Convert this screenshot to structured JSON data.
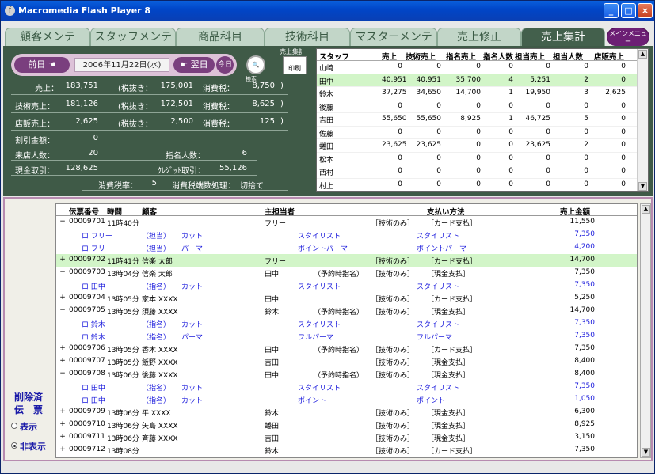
{
  "window": {
    "title": "Macromedia Flash Player 8",
    "min": "_",
    "max": "□",
    "close": "×"
  },
  "tabs": [
    "顧客メンテ",
    "スタッフメンテ",
    "商品科目",
    "技術科目",
    "マスターメンテ",
    "売上修正",
    "売上集計"
  ],
  "menu_btn": "メインメニュー",
  "datebar": {
    "prev": "前日",
    "date": "2006年11月22日(水)",
    "next": "翌日",
    "today": "今日"
  },
  "search_label": "検索",
  "print": {
    "top": "売上集計",
    "label": "印刷"
  },
  "summary": {
    "sales_label": "売上：",
    "sales": "183,751",
    "taxex_label": "(税抜き：",
    "sales_ex": "175,001",
    "tax_label": "消費税：",
    "sales_tax": "8,750",
    "tech_label": "技術売上：",
    "tech": "181,126",
    "tech_ex": "172,501",
    "tech_tax": "8,625",
    "shop_label": "店販売上：",
    "shop": "2,625",
    "shop_ex": "2,500",
    "shop_tax": "125",
    "discount_label": "割引金額：",
    "discount": "0",
    "visitors_label": "来店人数：",
    "visitors": "20",
    "nominated_label": "指名人数：",
    "nominated": "6",
    "cash_label": "現金取引：",
    "cash": "128,625",
    "credit_label": "ｸﾚｼﾞｯﾄ取引：",
    "credit": "55,126",
    "taxrate_label": "消費税率：",
    "taxrate": "5",
    "rounding_label": "消費税端数処理：",
    "rounding": "切捨て",
    "paren": ")"
  },
  "staff_headers": [
    "スタッフ",
    "売上",
    "技術売上",
    "指名売上",
    "指名人数",
    "担当売上",
    "担当人数",
    "店販売上"
  ],
  "staff_rows": [
    [
      "山崎",
      "0",
      "0",
      "0",
      "0",
      "0",
      "0",
      "0"
    ],
    [
      "田中",
      "40,951",
      "40,951",
      "35,700",
      "4",
      "5,251",
      "2",
      "0"
    ],
    [
      "鈴木",
      "37,275",
      "34,650",
      "14,700",
      "1",
      "19,950",
      "3",
      "2,625"
    ],
    [
      "後藤",
      "0",
      "0",
      "0",
      "0",
      "0",
      "0",
      "0"
    ],
    [
      "吉田",
      "55,650",
      "55,650",
      "8,925",
      "1",
      "46,725",
      "5",
      "0"
    ],
    [
      "佐藤",
      "0",
      "0",
      "0",
      "0",
      "0",
      "0",
      "0"
    ],
    [
      "蜷田",
      "23,625",
      "23,625",
      "0",
      "0",
      "23,625",
      "2",
      "0"
    ],
    [
      "松本",
      "0",
      "0",
      "0",
      "0",
      "0",
      "0",
      "0"
    ],
    [
      "西村",
      "0",
      "0",
      "0",
      "0",
      "0",
      "0",
      "0"
    ],
    [
      "村上",
      "0",
      "0",
      "0",
      "0",
      "0",
      "0",
      "0"
    ]
  ],
  "side": {
    "title1": "削除済",
    "title2": "伝　票",
    "show": "表示",
    "hide": "非表示"
  },
  "detail_headers": {
    "no": "伝票番号",
    "time": "時間",
    "customer": "顧客",
    "main": "主担当者",
    "pay": "支払い方法",
    "amount": "売上金額"
  },
  "detail_rows": [
    {
      "t": "m",
      "exp": "−",
      "no": "00009701",
      "time": "11時40分",
      "cust": "",
      "main": "フリー",
      "tech": "［技術のみ］",
      "pay": "［カード支払］",
      "amt": "11,550"
    },
    {
      "t": "s",
      "a": "ロ フリー",
      "b": "（担当）",
      "c": "カット",
      "d": "スタイリスト",
      "e": "スタイリスト",
      "amt": "7,350"
    },
    {
      "t": "s",
      "a": "ロ フリー",
      "b": "（担当）",
      "c": "パーマ",
      "d": "ポイントパーマ",
      "e": "ポイントパーマ",
      "amt": "4,200"
    },
    {
      "t": "m",
      "hl": true,
      "exp": "+",
      "no": "00009702",
      "time": "11時41分",
      "cust": "信楽 太郎",
      "main": "フリー",
      "tech": "［技術のみ］",
      "pay": "［カード支払］",
      "amt": "14,700"
    },
    {
      "t": "m",
      "exp": "−",
      "no": "00009703",
      "time": "13時04分",
      "cust": "信楽 太郎",
      "main": "田中",
      "nom": "（予約時指名）",
      "tech": "［技術のみ］",
      "pay": "［現金支払］",
      "amt": "7,350"
    },
    {
      "t": "s",
      "a": "ロ 田中",
      "b": "（指名）",
      "c": "カット",
      "d": "スタイリスト",
      "e": "スタイリスト",
      "amt": "7,350"
    },
    {
      "t": "m",
      "exp": "+",
      "no": "00009704",
      "time": "13時05分",
      "cust": "家本 XXXX",
      "main": "田中",
      "tech": "［技術のみ］",
      "pay": "［カード支払］",
      "amt": "5,250"
    },
    {
      "t": "m",
      "exp": "−",
      "no": "00009705",
      "time": "13時05分",
      "cust": "須藤 XXXX",
      "main": "鈴木",
      "nom": "（予約時指名）",
      "tech": "［技術のみ］",
      "pay": "［現金支払］",
      "amt": "14,700"
    },
    {
      "t": "s",
      "a": "ロ 鈴木",
      "b": "（指名）",
      "c": "カット",
      "d": "スタイリスト",
      "e": "スタイリスト",
      "amt": "7,350"
    },
    {
      "t": "s",
      "a": "ロ 鈴木",
      "b": "（指名）",
      "c": "パーマ",
      "d": "フルパーマ",
      "e": "フルパーマ",
      "amt": "7,350"
    },
    {
      "t": "m",
      "exp": "+",
      "no": "00009706",
      "time": "13時05分",
      "cust": "香木 XXXX",
      "main": "田中",
      "nom": "（予約時指名）",
      "tech": "［技術のみ］",
      "pay": "［カード支払］",
      "amt": "7,350"
    },
    {
      "t": "m",
      "exp": "+",
      "no": "00009707",
      "time": "13時05分",
      "cust": "飯野 XXXX",
      "main": "吉田",
      "tech": "［技術のみ］",
      "pay": "［現金支払］",
      "amt": "8,400"
    },
    {
      "t": "m",
      "exp": "−",
      "no": "00009708",
      "time": "13時06分",
      "cust": "後藤 XXXX",
      "main": "田中",
      "nom": "（予約時指名）",
      "tech": "［技術のみ］",
      "pay": "［現金支払］",
      "amt": "8,400"
    },
    {
      "t": "s",
      "a": "ロ 田中",
      "b": "（指名）",
      "c": "カット",
      "d": "スタイリスト",
      "e": "スタイリスト",
      "amt": "7,350"
    },
    {
      "t": "s",
      "a": "ロ 田中",
      "b": "（指名）",
      "c": "カット",
      "d": "ポイント",
      "e": "ポイント",
      "amt": "1,050"
    },
    {
      "t": "m",
      "exp": "+",
      "no": "00009709",
      "time": "13時06分",
      "cust": "平 XXXX",
      "main": "鈴木",
      "tech": "［技術のみ］",
      "pay": "［現金支払］",
      "amt": "6,300"
    },
    {
      "t": "m",
      "exp": "+",
      "no": "00009710",
      "time": "13時06分",
      "cust": "矢島 XXXX",
      "main": "蜷田",
      "tech": "［技術のみ］",
      "pay": "［現金支払］",
      "amt": "8,925"
    },
    {
      "t": "m",
      "exp": "+",
      "no": "00009711",
      "time": "13時06分",
      "cust": "斉藤 XXXX",
      "main": "吉田",
      "tech": "［技術のみ］",
      "pay": "［現金支払］",
      "amt": "3,150"
    },
    {
      "t": "m",
      "exp": "+",
      "no": "00009712",
      "time": "13時08分",
      "cust": "",
      "main": "鈴木",
      "tech": "［技術のみ］",
      "pay": "［カード支払］",
      "amt": "7,350"
    }
  ],
  "scroll": {
    "up": "▲",
    "down": "▼"
  }
}
